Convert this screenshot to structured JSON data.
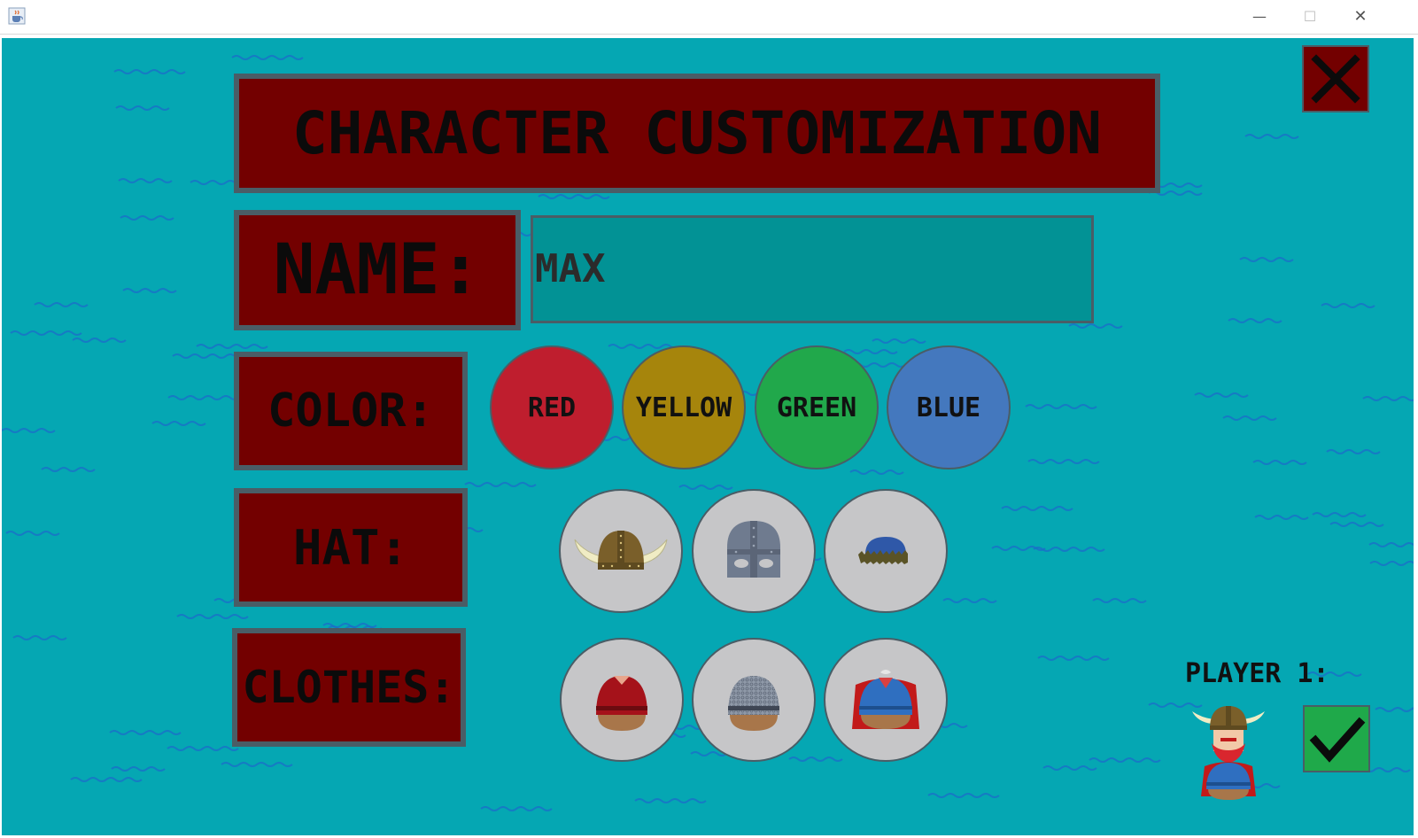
{
  "window": {
    "icon": "java-coffee-cup-icon",
    "controls": {
      "minimize": "—",
      "maximize": "☐",
      "close": "✕"
    }
  },
  "screen": {
    "title": "CHARACTER CUSTOMIZATION",
    "name_label": "NAME:",
    "name_value": "MAX",
    "color_label": "COLOR:",
    "colors": [
      {
        "label": "RED",
        "hex": "#bf1e2e"
      },
      {
        "label": "YELLOW",
        "hex": "#a6850c"
      },
      {
        "label": "GREEN",
        "hex": "#21a84b"
      },
      {
        "label": "BLUE",
        "hex": "#4478be"
      }
    ],
    "hat_label": "HAT:",
    "hats": [
      "horned-helmet-icon",
      "iron-helmet-icon",
      "fur-cap-icon"
    ],
    "clothes_label": "CLOTHES:",
    "clothes": [
      "red-tunic-icon",
      "chainmail-icon",
      "blue-tunic-cape-icon"
    ],
    "player_label": "PLAYER 1:",
    "close_icon": "close-x-icon",
    "confirm_icon": "checkmark-icon"
  },
  "theme": {
    "background": "#05a7b3",
    "wave_color": "#1a6fc8",
    "panel": "#730000",
    "panel_border": "#4a5d66",
    "input_bg": "#029295",
    "option_bg": "#c6c6c8"
  }
}
